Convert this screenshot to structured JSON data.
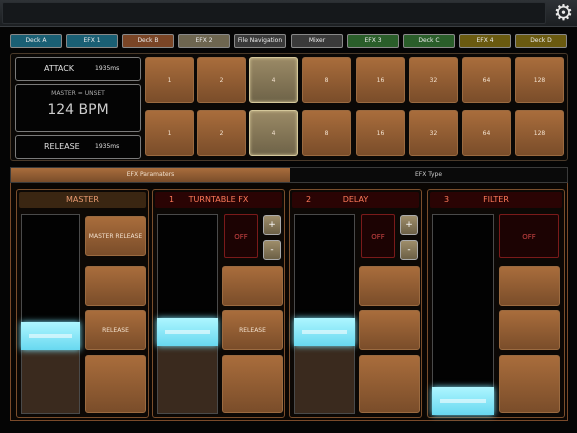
{
  "deck_tabs": [
    {
      "label": "Deck A",
      "color": "#1a5f74"
    },
    {
      "label": "EFX 1",
      "color": "#1a5f74"
    },
    {
      "label": "Deck B",
      "color": "#7a4526"
    },
    {
      "label": "EFX 2",
      "color": "#6e6650"
    },
    {
      "label": "File Navigation",
      "color": "#3a3a3a"
    },
    {
      "label": "Mixer",
      "color": "#3a3a3a"
    },
    {
      "label": "EFX 3",
      "color": "#2a5e2a"
    },
    {
      "label": "Deck C",
      "color": "#2a5e2a"
    },
    {
      "label": "EFX 4",
      "color": "#6a5a10"
    },
    {
      "label": "Deck D",
      "color": "#6a5a10"
    }
  ],
  "header": {
    "attack": {
      "label": "ATTACK",
      "value": "1935ms"
    },
    "release": {
      "label": "RELEASE",
      "value": "1935ms"
    },
    "master_status": "MASTER = UNSET",
    "bpm": "124 BPM",
    "beat_rows": [
      {
        "labels": [
          "1",
          "2",
          "4",
          "8",
          "16",
          "32",
          "64",
          "128"
        ],
        "selected_index": 2
      },
      {
        "labels": [
          "1",
          "2",
          "4",
          "8",
          "16",
          "32",
          "64",
          "128"
        ],
        "selected_index": 2
      }
    ]
  },
  "section_tabs": [
    {
      "label": "EFX Paramaters",
      "active": true
    },
    {
      "label": "EFX Type",
      "active": false
    }
  ],
  "columns": [
    {
      "number": "",
      "title": "MASTER",
      "level": 0.38,
      "buttons": [
        "MASTER RELEASE",
        "",
        "RELEASE",
        ""
      ]
    },
    {
      "number": "1",
      "title": "TURNTABLE FX",
      "level": 0.4,
      "off_label": "OFF",
      "plus": "+",
      "minus": "-",
      "buttons": [
        "",
        "RELEASE",
        ""
      ]
    },
    {
      "number": "2",
      "title": "DELAY",
      "level": 0.4,
      "off_label": "OFF",
      "plus": "+",
      "minus": "-",
      "buttons": [
        "",
        "",
        ""
      ]
    },
    {
      "number": "3",
      "title": "FILTER",
      "level": 0.0,
      "off_label": "OFF",
      "buttons": [
        "",
        "",
        ""
      ]
    }
  ],
  "icons": {
    "settings": "gear-icon"
  }
}
